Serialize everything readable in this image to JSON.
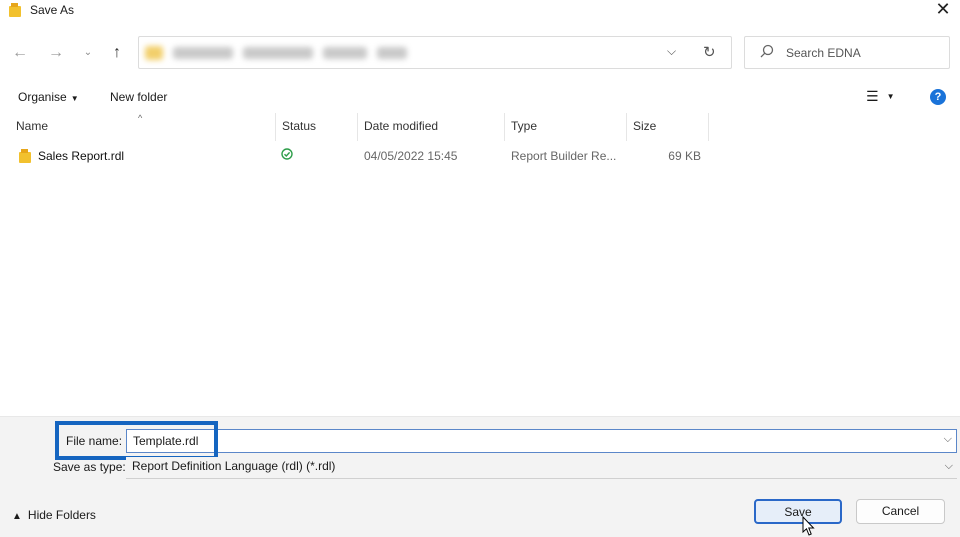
{
  "window": {
    "title": "Save As"
  },
  "nav": {
    "search_placeholder": "Search EDNA"
  },
  "commands": {
    "organise": "Organise",
    "new_folder": "New folder"
  },
  "columns": [
    "Name",
    "Status",
    "Date modified",
    "Type",
    "Size"
  ],
  "files": [
    {
      "name": "Sales Report.rdl",
      "status": "synced",
      "date_modified": "04/05/2022 15:45",
      "type": "Report Builder Re...",
      "size": "69 KB"
    }
  ],
  "form": {
    "file_name_label": "File name:",
    "file_name_value": "Template.rdl",
    "save_as_type_label": "Save as type:",
    "save_as_type_value": "Report Definition Language (rdl)  (*.rdl)"
  },
  "footer": {
    "hide_folders": "Hide Folders",
    "save": "Save",
    "cancel": "Cancel"
  },
  "colors": {
    "accent": "#1565c0",
    "status_ok": "#2e9e4a",
    "folder_yellow": "#f2cf6b",
    "help_blue": "#1a73d9"
  }
}
